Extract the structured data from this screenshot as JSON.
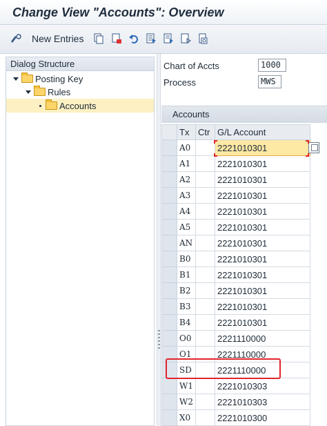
{
  "title": "Change View \"Accounts\": Overview",
  "toolbar": {
    "new_entries_label": "New Entries",
    "icons": [
      "display-change-icon",
      "copy-icon",
      "delete-icon",
      "undo-icon",
      "select-all-icon",
      "select-block-icon",
      "deselect-all-icon",
      "print-icon"
    ]
  },
  "dialog": {
    "header": "Dialog Structure",
    "tree": [
      {
        "label": "Posting Key",
        "level": 1,
        "expanded": true
      },
      {
        "label": "Rules",
        "level": 2,
        "expanded": true
      },
      {
        "label": "Accounts",
        "level": 3,
        "selected": true
      }
    ]
  },
  "fields": {
    "chart_label": "Chart of Accts",
    "chart_value": "1000",
    "process_label": "Process",
    "process_value": "MWS"
  },
  "accounts": {
    "header": "Accounts",
    "columns": [
      "Tx",
      "Ctr",
      "G/L Account"
    ],
    "rows": [
      {
        "tx": "A0",
        "ctr": "",
        "gl": "2221010301"
      },
      {
        "tx": "A1",
        "ctr": "",
        "gl": "2221010301"
      },
      {
        "tx": "A2",
        "ctr": "",
        "gl": "2221010301"
      },
      {
        "tx": "A3",
        "ctr": "",
        "gl": "2221010301"
      },
      {
        "tx": "A4",
        "ctr": "",
        "gl": "2221010301"
      },
      {
        "tx": "A5",
        "ctr": "",
        "gl": "2221010301"
      },
      {
        "tx": "AN",
        "ctr": "",
        "gl": "2221010301"
      },
      {
        "tx": "B0",
        "ctr": "",
        "gl": "2221010301"
      },
      {
        "tx": "B1",
        "ctr": "",
        "gl": "2221010301"
      },
      {
        "tx": "B2",
        "ctr": "",
        "gl": "2221010301"
      },
      {
        "tx": "B3",
        "ctr": "",
        "gl": "2221010301"
      },
      {
        "tx": "B4",
        "ctr": "",
        "gl": "2221010301"
      },
      {
        "tx": "O0",
        "ctr": "",
        "gl": "2221110000"
      },
      {
        "tx": "O1",
        "ctr": "",
        "gl": "2221110000"
      },
      {
        "tx": "SD",
        "ctr": "",
        "gl": "2221110000"
      },
      {
        "tx": "W1",
        "ctr": "",
        "gl": "2221010303"
      },
      {
        "tx": "W2",
        "ctr": "",
        "gl": "2221010303"
      },
      {
        "tx": "X0",
        "ctr": "",
        "gl": "2221010300"
      }
    ]
  },
  "colors": {
    "highlight": "#e0242a",
    "active_cell": "#fde8a4",
    "tree_selected": "#fdf0c2"
  }
}
